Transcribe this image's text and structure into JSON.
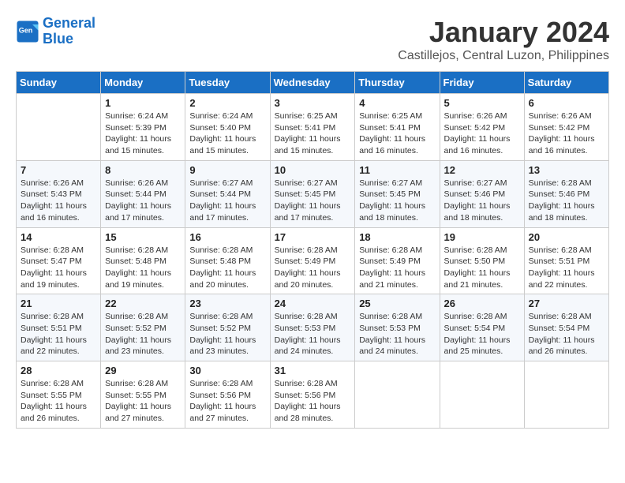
{
  "logo": {
    "line1": "General",
    "line2": "Blue"
  },
  "title": "January 2024",
  "location": "Castillejos, Central Luzon, Philippines",
  "days_header": [
    "Sunday",
    "Monday",
    "Tuesday",
    "Wednesday",
    "Thursday",
    "Friday",
    "Saturday"
  ],
  "weeks": [
    [
      {
        "day": "",
        "content": ""
      },
      {
        "day": "1",
        "content": "Sunrise: 6:24 AM\nSunset: 5:39 PM\nDaylight: 11 hours\nand 15 minutes."
      },
      {
        "day": "2",
        "content": "Sunrise: 6:24 AM\nSunset: 5:40 PM\nDaylight: 11 hours\nand 15 minutes."
      },
      {
        "day": "3",
        "content": "Sunrise: 6:25 AM\nSunset: 5:41 PM\nDaylight: 11 hours\nand 15 minutes."
      },
      {
        "day": "4",
        "content": "Sunrise: 6:25 AM\nSunset: 5:41 PM\nDaylight: 11 hours\nand 16 minutes."
      },
      {
        "day": "5",
        "content": "Sunrise: 6:26 AM\nSunset: 5:42 PM\nDaylight: 11 hours\nand 16 minutes."
      },
      {
        "day": "6",
        "content": "Sunrise: 6:26 AM\nSunset: 5:42 PM\nDaylight: 11 hours\nand 16 minutes."
      }
    ],
    [
      {
        "day": "7",
        "content": "Sunrise: 6:26 AM\nSunset: 5:43 PM\nDaylight: 11 hours\nand 16 minutes."
      },
      {
        "day": "8",
        "content": "Sunrise: 6:26 AM\nSunset: 5:44 PM\nDaylight: 11 hours\nand 17 minutes."
      },
      {
        "day": "9",
        "content": "Sunrise: 6:27 AM\nSunset: 5:44 PM\nDaylight: 11 hours\nand 17 minutes."
      },
      {
        "day": "10",
        "content": "Sunrise: 6:27 AM\nSunset: 5:45 PM\nDaylight: 11 hours\nand 17 minutes."
      },
      {
        "day": "11",
        "content": "Sunrise: 6:27 AM\nSunset: 5:45 PM\nDaylight: 11 hours\nand 18 minutes."
      },
      {
        "day": "12",
        "content": "Sunrise: 6:27 AM\nSunset: 5:46 PM\nDaylight: 11 hours\nand 18 minutes."
      },
      {
        "day": "13",
        "content": "Sunrise: 6:28 AM\nSunset: 5:46 PM\nDaylight: 11 hours\nand 18 minutes."
      }
    ],
    [
      {
        "day": "14",
        "content": "Sunrise: 6:28 AM\nSunset: 5:47 PM\nDaylight: 11 hours\nand 19 minutes."
      },
      {
        "day": "15",
        "content": "Sunrise: 6:28 AM\nSunset: 5:48 PM\nDaylight: 11 hours\nand 19 minutes."
      },
      {
        "day": "16",
        "content": "Sunrise: 6:28 AM\nSunset: 5:48 PM\nDaylight: 11 hours\nand 20 minutes."
      },
      {
        "day": "17",
        "content": "Sunrise: 6:28 AM\nSunset: 5:49 PM\nDaylight: 11 hours\nand 20 minutes."
      },
      {
        "day": "18",
        "content": "Sunrise: 6:28 AM\nSunset: 5:49 PM\nDaylight: 11 hours\nand 21 minutes."
      },
      {
        "day": "19",
        "content": "Sunrise: 6:28 AM\nSunset: 5:50 PM\nDaylight: 11 hours\nand 21 minutes."
      },
      {
        "day": "20",
        "content": "Sunrise: 6:28 AM\nSunset: 5:51 PM\nDaylight: 11 hours\nand 22 minutes."
      }
    ],
    [
      {
        "day": "21",
        "content": "Sunrise: 6:28 AM\nSunset: 5:51 PM\nDaylight: 11 hours\nand 22 minutes."
      },
      {
        "day": "22",
        "content": "Sunrise: 6:28 AM\nSunset: 5:52 PM\nDaylight: 11 hours\nand 23 minutes."
      },
      {
        "day": "23",
        "content": "Sunrise: 6:28 AM\nSunset: 5:52 PM\nDaylight: 11 hours\nand 23 minutes."
      },
      {
        "day": "24",
        "content": "Sunrise: 6:28 AM\nSunset: 5:53 PM\nDaylight: 11 hours\nand 24 minutes."
      },
      {
        "day": "25",
        "content": "Sunrise: 6:28 AM\nSunset: 5:53 PM\nDaylight: 11 hours\nand 24 minutes."
      },
      {
        "day": "26",
        "content": "Sunrise: 6:28 AM\nSunset: 5:54 PM\nDaylight: 11 hours\nand 25 minutes."
      },
      {
        "day": "27",
        "content": "Sunrise: 6:28 AM\nSunset: 5:54 PM\nDaylight: 11 hours\nand 26 minutes."
      }
    ],
    [
      {
        "day": "28",
        "content": "Sunrise: 6:28 AM\nSunset: 5:55 PM\nDaylight: 11 hours\nand 26 minutes."
      },
      {
        "day": "29",
        "content": "Sunrise: 6:28 AM\nSunset: 5:55 PM\nDaylight: 11 hours\nand 27 minutes."
      },
      {
        "day": "30",
        "content": "Sunrise: 6:28 AM\nSunset: 5:56 PM\nDaylight: 11 hours\nand 27 minutes."
      },
      {
        "day": "31",
        "content": "Sunrise: 6:28 AM\nSunset: 5:56 PM\nDaylight: 11 hours\nand 28 minutes."
      },
      {
        "day": "",
        "content": ""
      },
      {
        "day": "",
        "content": ""
      },
      {
        "day": "",
        "content": ""
      }
    ]
  ]
}
